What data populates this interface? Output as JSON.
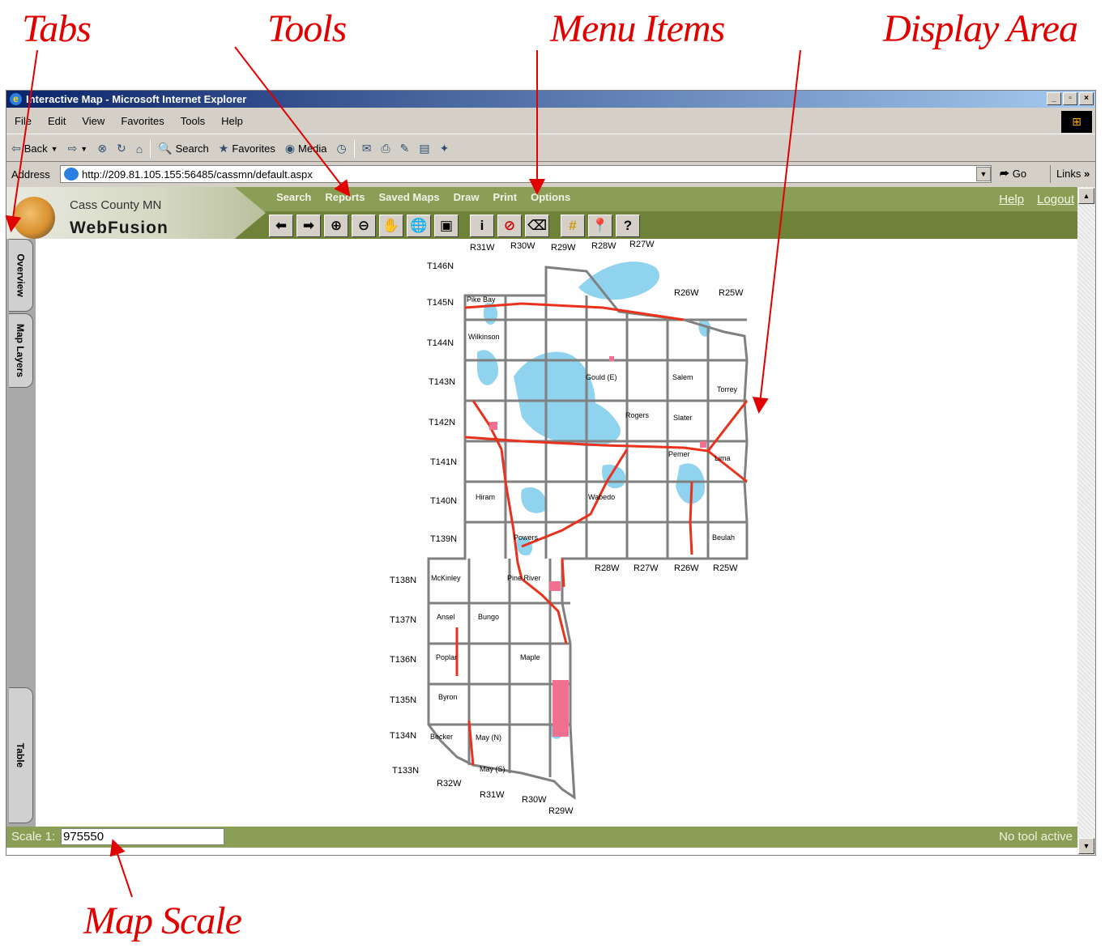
{
  "annotations": {
    "tabs": "Tabs",
    "tools": "Tools",
    "menu_items": "Menu Items",
    "display_area": "Display Area",
    "map_scale": "Map Scale"
  },
  "browser": {
    "title": "Interactive Map - Microsoft Internet Explorer",
    "menu": [
      "File",
      "Edit",
      "View",
      "Favorites",
      "Tools",
      "Help"
    ],
    "toolbar": {
      "back": "Back",
      "search": "Search",
      "favorites": "Favorites",
      "media": "Media"
    },
    "address_label": "Address",
    "url": "http://209.81.105.155:56485/cassmn/default.aspx",
    "go": "Go",
    "links": "Links",
    "window_buttons": [
      "_",
      "▫",
      "×"
    ]
  },
  "app": {
    "county": "Cass County MN",
    "product": "WebFusion",
    "menu": [
      "Search",
      "Reports",
      "Saved Maps",
      "Draw",
      "Print",
      "Options"
    ],
    "help": "Help",
    "logout": "Logout",
    "tools": [
      {
        "name": "back-extent-icon",
        "glyph": "⬅"
      },
      {
        "name": "forward-extent-icon",
        "glyph": "➡"
      },
      {
        "name": "zoom-in-icon",
        "glyph": "⊕"
      },
      {
        "name": "zoom-out-icon",
        "glyph": "⊖"
      },
      {
        "name": "pan-hand-icon",
        "glyph": "✋"
      },
      {
        "name": "full-extent-globe-icon",
        "glyph": "🌐"
      },
      {
        "name": "zoom-layer-icon",
        "glyph": "▣"
      },
      {
        "name": "info-icon",
        "glyph": "i"
      },
      {
        "name": "no-identify-icon",
        "glyph": "⊘"
      },
      {
        "name": "eraser-icon",
        "glyph": "⌫"
      },
      {
        "name": "select-grid-icon",
        "glyph": "#"
      },
      {
        "name": "map-pin-icon",
        "glyph": "📍"
      },
      {
        "name": "measure-icon",
        "glyph": "?"
      }
    ],
    "tabs": [
      "Overview",
      "Map Layers",
      "Table"
    ],
    "scale_label": "Scale 1:",
    "scale_value": "975550",
    "tool_status": "No tool active"
  },
  "map": {
    "range_labels_top": [
      "R31W",
      "R30W",
      "R29W",
      "R28W",
      "R27W",
      "R26W",
      "R25W"
    ],
    "range_labels_mid": [
      "R28W",
      "R27W",
      "R26W",
      "R25W"
    ],
    "range_labels_bottom": [
      "R32W",
      "R31W",
      "R30W",
      "R29W"
    ],
    "township_labels": [
      "T146N",
      "T145N",
      "T144N",
      "T143N",
      "T142N",
      "T141N",
      "T140N",
      "T139N",
      "T138N",
      "T137N",
      "T136N",
      "T135N",
      "T134N",
      "T133N"
    ],
    "place_labels": [
      "Pike Bay",
      "Wilkinson",
      "Gould (E)",
      "Salem",
      "Torrey",
      "Rogers",
      "Slater",
      "Pemer",
      "Lima",
      "Hiram",
      "Wabedo",
      "Powers",
      "Beulah",
      "McKinley",
      "Pine River",
      "Ansel",
      "Bungo",
      "Poplar",
      "Maple",
      "Byron",
      "Becker",
      "May (N)",
      "May (S)"
    ]
  },
  "colors": {
    "annotation": "#e00000",
    "header_green": "#8b9e55",
    "road_red": "#e8321e",
    "water_blue": "#8fd3ee",
    "boundary_gray": "#808080",
    "town_pink": "#f07090"
  }
}
